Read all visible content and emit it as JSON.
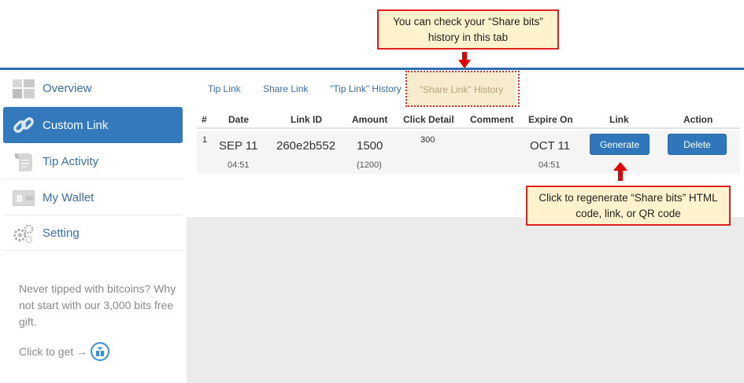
{
  "callouts": {
    "tab_hint": "You can check your “Share bits” history in this tab",
    "regen_hint": "Click to regenerate “Share bits” HTML code, link, or QR code"
  },
  "sidebar": {
    "items": [
      {
        "label": "Overview",
        "icon": "grid-icon"
      },
      {
        "label": "Custom Link",
        "icon": "chain-link-icon",
        "active": true
      },
      {
        "label": "Tip Activity",
        "icon": "scroll-icon"
      },
      {
        "label": "My Wallet",
        "icon": "wallet-icon"
      },
      {
        "label": "Setting",
        "icon": "gears-icon"
      }
    ],
    "promo_text": "Never tipped with bitcoins? Why not start with our 3,000 bits free gift.",
    "promo_link": "Click to get →"
  },
  "tabs": [
    "Tip Link",
    "Share Link",
    "\"Tip Link\" History",
    "\"Share Link\" History"
  ],
  "table": {
    "headers": [
      "#",
      "Date",
      "Link ID",
      "Amount",
      "Click Detail",
      "Comment",
      "Expire On",
      "Link",
      "Action"
    ],
    "row": {
      "num": "1",
      "date": "SEP 11",
      "time": "04:51",
      "link_id": "260e2b552",
      "amount": "1500",
      "amount_sub": "(1200)",
      "click_detail": "300",
      "comment": "",
      "expire_date": "OCT 11",
      "expire_time": "04:51",
      "generate_label": "Generate",
      "delete_label": "Delete"
    }
  },
  "colors": {
    "accent": "#3579bd",
    "callout_bg": "#fff2cc",
    "callout_border": "#e02020",
    "arrow": "#e00000"
  }
}
